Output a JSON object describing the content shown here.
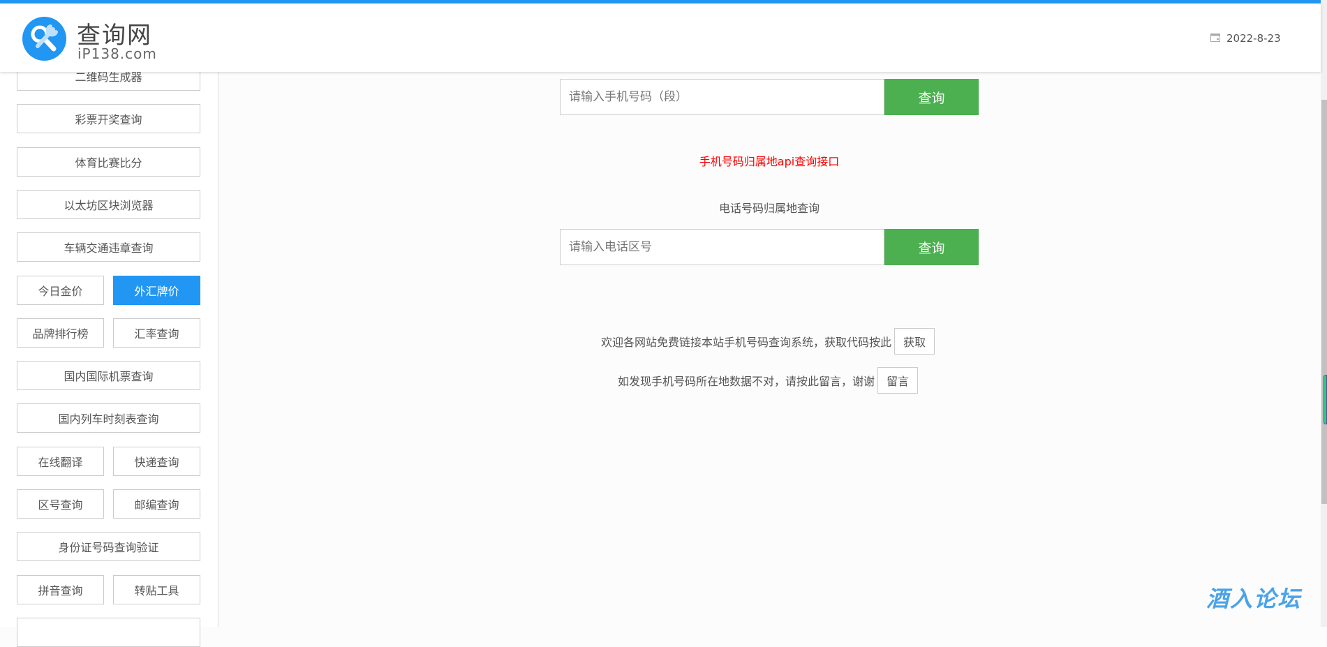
{
  "header": {
    "logo_title": "查询网",
    "logo_subtitle": "iP138.com",
    "date": "2022-8-23"
  },
  "sidebar": {
    "rows": [
      [
        "二维码生成器"
      ],
      [
        "彩票开奖查询"
      ],
      [
        "体育比赛比分"
      ],
      [
        "以太坊区块浏览器"
      ],
      [
        "车辆交通违章查询"
      ],
      [
        "今日金价",
        "外汇牌价"
      ],
      [
        "品牌排行榜",
        "汇率查询"
      ],
      [
        "国内国际机票查询"
      ],
      [
        "国内列车时刻表查询"
      ],
      [
        "在线翻译",
        "快递查询"
      ],
      [
        "区号查询",
        "邮编查询"
      ],
      [
        "身份证号码查询验证"
      ],
      [
        "拼音查询",
        "转贴工具"
      ]
    ],
    "active": "外汇牌价"
  },
  "main": {
    "mobile_placeholder": "请输入手机号码（段）",
    "query_label": "查询",
    "api_link": "手机号码归属地api查询接口",
    "phone_title": "电话号码归属地查询",
    "area_placeholder": "请输入电话区号",
    "link_text": "欢迎各网站免费链接本站手机号码查询系统，获取代码按此",
    "link_button": "获取",
    "feedback_text": "如发现手机号码所在地数据不对，请按此留言，谢谢",
    "feedback_button": "留言"
  },
  "watermark": "酒入论坛",
  "colors": {
    "accent": "#2196f3",
    "query_button": "#4caf50",
    "link": "#ff0000"
  }
}
